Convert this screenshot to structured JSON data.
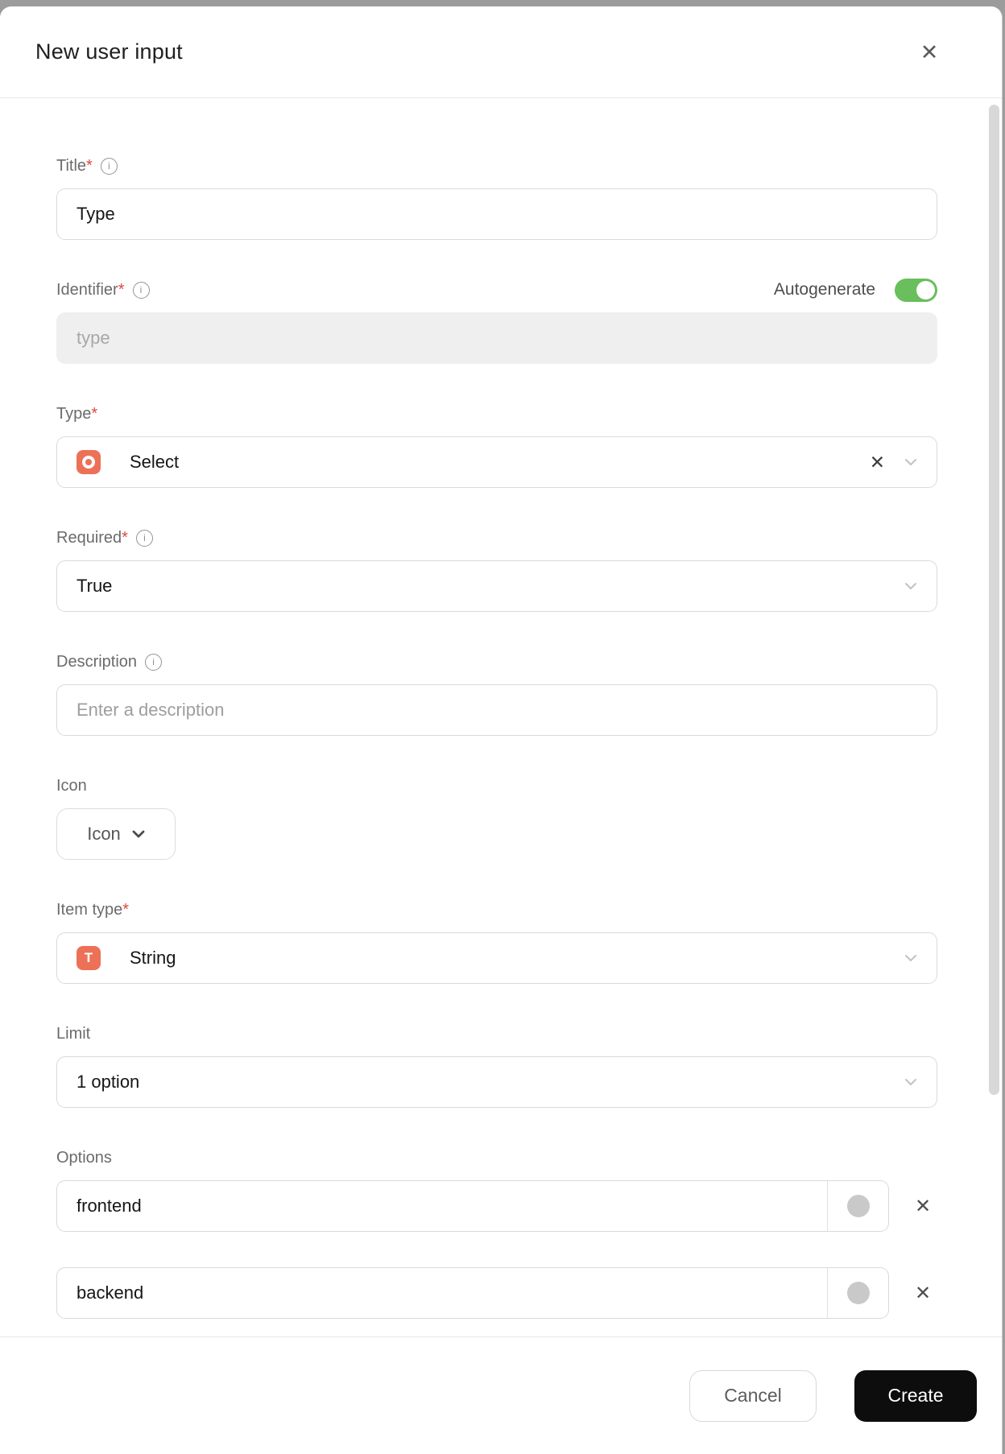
{
  "dialog": {
    "title": "New user input"
  },
  "icons": {
    "close": "✕",
    "clear": "✕",
    "remove": "✕",
    "info": "i"
  },
  "fields": {
    "title": {
      "label": "Title",
      "required_mark": "*",
      "value": "Type"
    },
    "identifier": {
      "label": "Identifier",
      "required_mark": "*",
      "placeholder": "type",
      "autogenerate_label": "Autogenerate",
      "autogenerate_state": "on"
    },
    "type": {
      "label": "Type",
      "required_mark": "*",
      "value": "Select",
      "icon": "select-donut"
    },
    "required": {
      "label": "Required",
      "required_mark": "*",
      "value": "True"
    },
    "description": {
      "label": "Description",
      "placeholder": "Enter a description"
    },
    "icon": {
      "label": "Icon",
      "button_label": "Icon"
    },
    "item_type": {
      "label": "Item type",
      "required_mark": "*",
      "value": "String",
      "icon_letter": "T"
    },
    "limit": {
      "label": "Limit",
      "value": "1 option"
    },
    "options": {
      "label": "Options",
      "items": [
        "frontend",
        "backend"
      ]
    }
  },
  "footer": {
    "cancel_label": "Cancel",
    "create_label": "Create"
  },
  "colors": {
    "accent_orange": "#ec7156",
    "toggle_green": "#68bf5b",
    "required_red": "#e0473c",
    "create_button": "#0d0d0d",
    "disabled_bg": "#efefef",
    "swatch_gray": "#c9c9c9"
  }
}
